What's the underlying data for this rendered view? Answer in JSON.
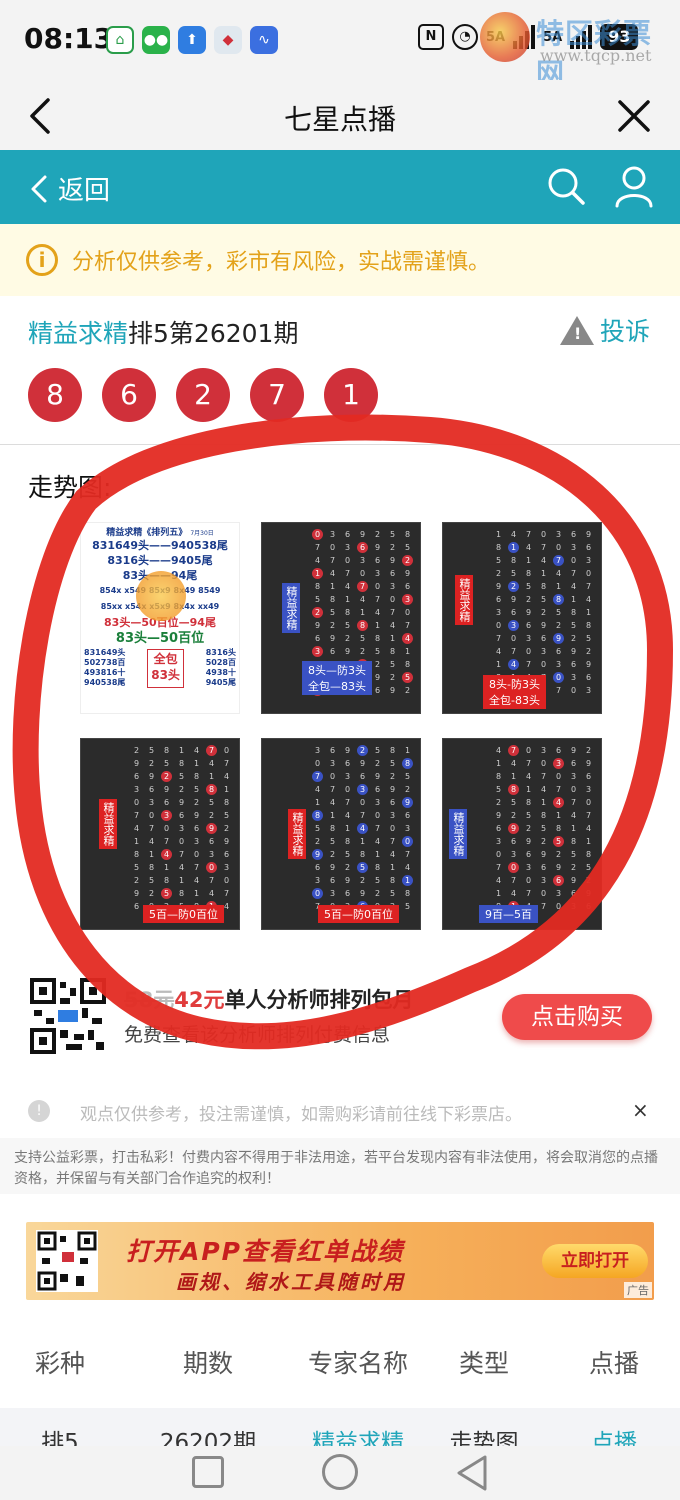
{
  "status_bar": {
    "time": "08:13",
    "signal_1": "5A",
    "signal_2": "5A",
    "battery": "93"
  },
  "watermark": {
    "title": "特区彩票网",
    "url": "www.tqcp.net"
  },
  "title_bar": {
    "title": "七星点播"
  },
  "nav": {
    "back_label": "返回"
  },
  "warning": {
    "text": "分析仅供参考，彩市有风险，实战需谨慎。"
  },
  "expert": {
    "name": "精益求精",
    "issue_text": "排5第26201期",
    "complaint_label": "投诉"
  },
  "numbers": [
    "8",
    "6",
    "2",
    "7",
    "1"
  ],
  "chart_label": "走势图:",
  "poster": {
    "header": "精益求精《排列五》",
    "header_date": "7月30日",
    "lines": [
      "831649头——940538尾",
      "8316头——9405尾",
      "83头——94尾"
    ],
    "row1": "854x  x549  85x9  8x49  8549",
    "row2": "85xx  x54x  x5x9  8x4x  xx49",
    "red_line": "83头—50百位—94尾",
    "green_line": "83头—50百位",
    "left_list": [
      "831649头",
      "502738百",
      "493816十",
      "940538尾"
    ],
    "center_box": [
      "全包",
      "83头"
    ],
    "right_list": [
      "8316头",
      "5028百",
      "4938十",
      "9405尾"
    ]
  },
  "thumbnails": [
    {
      "tag": "精益求精",
      "caption_1": "8头—防3头",
      "caption_2": "全包—83头"
    },
    {
      "tag": "精益求精",
      "caption_1": "8头-防3头",
      "caption_2": "全包-83头"
    },
    {
      "tag": "精益求精",
      "caption_1": "5百—防0百位"
    },
    {
      "tag": "精益求精",
      "caption_1": "5百—防0百位"
    },
    {
      "tag": "精益求精",
      "caption_1": "9百—5百"
    }
  ],
  "promo": {
    "old_price": "58元",
    "new_price": "42元",
    "title": "单人分析师排列包月",
    "desc": "免费查看该分析师排列付费信息",
    "buy_label": "点击购买"
  },
  "disclaimer": {
    "text": "观点仅供参考，投注需谨慎，如需购彩请前往线下彩票店。",
    "close": "×"
  },
  "notice": "支持公益彩票，打击私彩！付费内容不得用于非法用途，若平台发现内容有非法使用，将会取消您的点播资格，并保留与有关部门合作追究的权利！",
  "banner": {
    "title": "打开APP查看红单战绩",
    "subtitle": "画规、缩水工具随时用",
    "button": "立即打开",
    "ad_label": "广告"
  },
  "table": {
    "headers": [
      "彩种",
      "期数",
      "专家名称",
      "类型",
      "点播"
    ],
    "rows": [
      {
        "lottery": "排5",
        "issue": "26202期",
        "expert": "精益求精",
        "type": "走势图",
        "action": "点播"
      }
    ]
  },
  "colors": {
    "teal": "#1fa5b9",
    "ball_red": "#d0303a",
    "warning": "#e3a21a",
    "buy_red": "#ef4b4b"
  }
}
